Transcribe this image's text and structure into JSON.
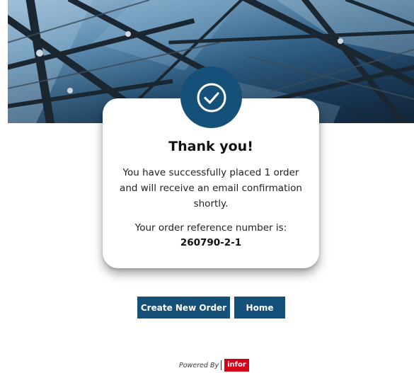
{
  "hero": {
    "image": "glass-roof-banner"
  },
  "icons": {
    "success": "check-circle-icon"
  },
  "card": {
    "title": "Thank you!",
    "message": "You have successfully placed 1 order and will receive an email confirmation shortly.",
    "reference_label": "Your order reference number is:",
    "reference_number": "260790-2-1"
  },
  "actions": {
    "create_new_order": "Create New Order",
    "home": "Home"
  },
  "footer": {
    "powered_by": "Powered By",
    "brand": "infor"
  },
  "colors": {
    "primary": "#155079",
    "brand_red": "#d4001a"
  }
}
